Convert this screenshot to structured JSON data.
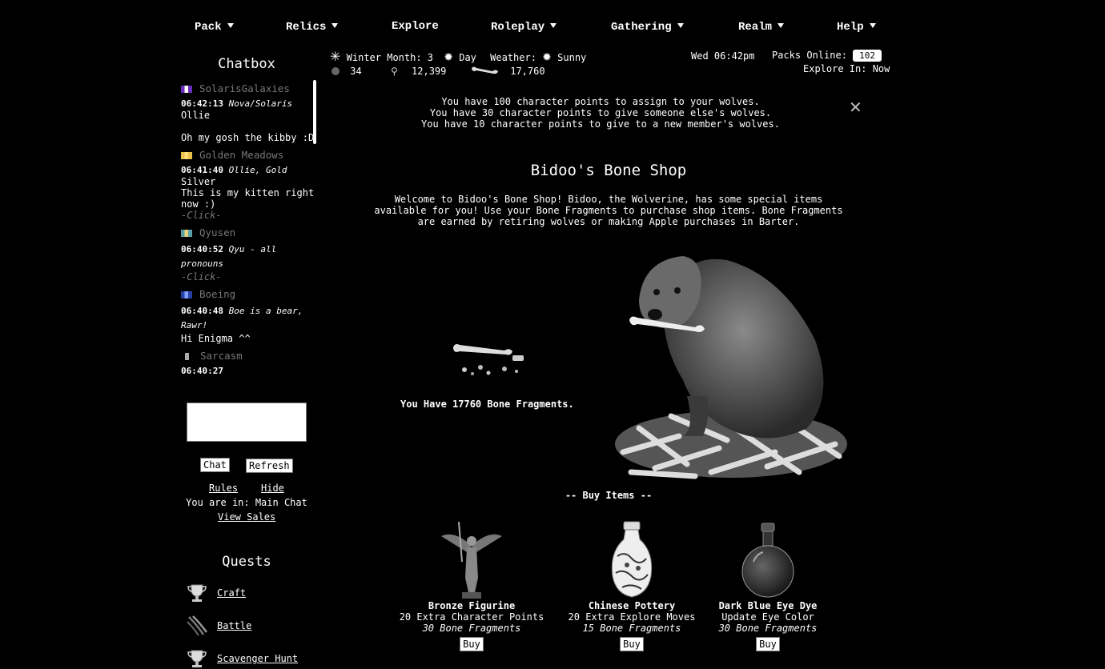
{
  "nav": {
    "items": [
      {
        "label": "Pack",
        "dropdown": true
      },
      {
        "label": "Relics",
        "dropdown": true
      },
      {
        "label": "Explore",
        "dropdown": false
      },
      {
        "label": "Roleplay",
        "dropdown": true
      },
      {
        "label": "Gathering",
        "dropdown": true
      },
      {
        "label": "Realm",
        "dropdown": true
      },
      {
        "label": "Help",
        "dropdown": true
      }
    ]
  },
  "chat": {
    "title": "Chatbox",
    "messages": [
      {
        "user": "SolarisGalaxies",
        "flag": [
          "#6a2bbf",
          "#ffffff",
          "#6a2bbf"
        ],
        "time": "06:42:13",
        "names": "Nova/Solaris",
        "lines": [
          "Ollie",
          "",
          "Oh my gosh the kibby :D"
        ],
        "click": ""
      },
      {
        "user": "Golden Meadows",
        "flag": [
          "#e8c04a",
          "#ffe27a",
          "#e8c04a"
        ],
        "time": "06:41:40",
        "names": "Ollie, Gold",
        "lines": [
          "Silver",
          "This is my kitten right now :)"
        ],
        "click": "-Click-"
      },
      {
        "user": "Qyusen",
        "flag": [
          "#5aa0a8",
          "#e8d27a",
          "#5aa0a8"
        ],
        "time": "06:40:52",
        "names": "Qyu - all pronouns",
        "lines": [],
        "click": "-Click-"
      },
      {
        "user": "Boeing",
        "flag": [
          "#2a3fa8",
          "#7fa0ff",
          "#2a3fa8"
        ],
        "time": "06:40:48",
        "names": "Boe is a bear, Rawr!",
        "lines": [
          "Hi Enigma ^^"
        ],
        "click": ""
      },
      {
        "user": "Sarcasm",
        "flag": [
          "#999999",
          "#bbbbbb",
          "#999999"
        ],
        "time": "06:40:27",
        "names": "",
        "lines": [],
        "click": ""
      }
    ],
    "chat_button": "Chat",
    "refresh_button": "Refresh",
    "rules_link": "Rules",
    "hide_link": "Hide",
    "location_text": "You are in: Main Chat",
    "view_sales_link": "View Sales"
  },
  "quests": {
    "title": "Quests",
    "items": [
      {
        "label": "Craft",
        "icon": "trophy-icon"
      },
      {
        "label": "Battle",
        "icon": "claw-marks-icon"
      },
      {
        "label": "Scavenger Hunt",
        "icon": "trophy-icon"
      }
    ]
  },
  "status": {
    "season": "Winter Month: 3",
    "time_of_day": "Day",
    "weather_label": "Weather:",
    "weather": "Sunny",
    "stat1": "34",
    "stat2": "12,399",
    "stat3": "17,760",
    "datetime": "Wed 06:42pm",
    "packs_online_label": "Packs Online:",
    "packs_online": "102",
    "explore_in": "Explore In: Now"
  },
  "points": {
    "line1": "You have 100 character points to assign to your wolves.",
    "line2": "You have 30 character points to give someone else's wolves.",
    "line3": "You have 10 character points to give to a new member's wolves."
  },
  "shop": {
    "title": "Bidoo's Bone Shop",
    "welcome": "Welcome to Bidoo's Bone Shop! Bidoo, the Wolverine, has some special items available for you! Use your Bone Fragments to purchase shop items. Bone Fragments are earned by retiring wolves or making Apple purchases in Barter.",
    "have_text": "You Have 17760 Bone Fragments.",
    "buy_heading": "-- Buy Items --",
    "items": [
      {
        "name": "Bronze Figurine",
        "desc": "20 Extra Character Points",
        "cost": "30 Bone Fragments",
        "button": "Buy"
      },
      {
        "name": "Chinese Pottery",
        "desc": "20 Extra Explore Moves",
        "cost": "15 Bone Fragments",
        "button": "Buy"
      },
      {
        "name": "Dark Blue Eye Dye",
        "desc": "Update Eye Color",
        "cost": "30 Bone Fragments",
        "button": "Buy"
      }
    ]
  }
}
